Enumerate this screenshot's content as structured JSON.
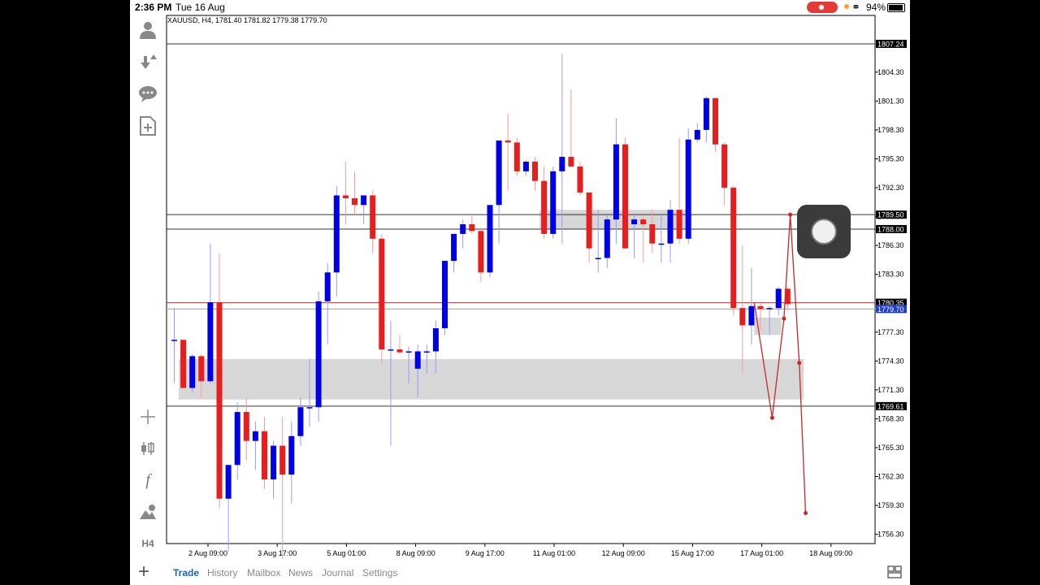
{
  "status_bar": {
    "time": "2:36 PM",
    "date": "Tue 16 Aug",
    "battery": "94%"
  },
  "sidebar": {
    "top_icons": [
      "person-icon",
      "download-icon",
      "chat-icon",
      "new-document-icon"
    ],
    "tool_icons": [
      "crosshair-icon",
      "chart-type-icon",
      "indicator-icon",
      "objects-icon"
    ],
    "timeframe": "H4"
  },
  "chart": {
    "symbol_info": "XAUUSD, H4, 1781.40 1781.82 1779.38 1779.70",
    "bull_color": "#0000e6",
    "bear_color": "#e61e1e",
    "price_ticks": [
      "1804.30",
      "1801.30",
      "1798.30",
      "1795.30",
      "1792.30",
      "1789.30",
      "1786.30",
      "1783.30",
      "1777.30",
      "1774.30",
      "1771.30",
      "1768.30",
      "1765.30",
      "1762.30",
      "1759.30",
      "1756.30"
    ],
    "price_tags": [
      {
        "label": "1807.24",
        "value": 1807.24,
        "type": "line"
      },
      {
        "label": "1789.50",
        "value": 1789.5,
        "type": "line"
      },
      {
        "label": "1788.00",
        "value": 1788.0,
        "type": "line"
      },
      {
        "label": "1780.35",
        "value": 1780.35,
        "type": "ask"
      },
      {
        "label": "1779.70",
        "value": 1779.7,
        "type": "bid"
      },
      {
        "label": "1769.61",
        "value": 1769.61,
        "type": "line"
      }
    ],
    "date_labels": [
      "2 Aug 09:00",
      "3 Aug 17:00",
      "5 Aug 01:00",
      "8 Aug 09:00",
      "9 Aug 17:00",
      "11 Aug 01:00",
      "12 Aug 09:00",
      "15 Aug 17:00",
      "17 Aug 01:00",
      "18 Aug 09:00"
    ],
    "candles": [
      [
        1776.5,
        1779.8,
        1772.0,
        1776.5
      ],
      [
        1776.5,
        1776.5,
        1771.5,
        1771.5
      ],
      [
        1771.5,
        1775.0,
        1771.0,
        1774.8
      ],
      [
        1774.8,
        1775.0,
        1770.5,
        1772.2
      ],
      [
        1772.2,
        1786.5,
        1772.0,
        1780.4
      ],
      [
        1780.4,
        1785.5,
        1759.0,
        1760.0
      ],
      [
        1760.0,
        1761.0,
        1754.5,
        1763.5
      ],
      [
        1763.5,
        1770.0,
        1762.0,
        1769.0
      ],
      [
        1769.0,
        1770.5,
        1764.0,
        1766.0
      ],
      [
        1766.0,
        1768.0,
        1763.0,
        1767.0
      ],
      [
        1767.0,
        1768.5,
        1761.0,
        1762.0
      ],
      [
        1762.0,
        1766.0,
        1760.0,
        1765.5
      ],
      [
        1765.5,
        1768.5,
        1753.0,
        1762.5
      ],
      [
        1762.5,
        1768.0,
        1759.5,
        1766.5
      ],
      [
        1766.5,
        1770.5,
        1765.5,
        1769.5
      ],
      [
        1769.5,
        1774.5,
        1767.5,
        1769.5
      ],
      [
        1769.5,
        1781.5,
        1768.0,
        1780.5
      ],
      [
        1780.5,
        1784.5,
        1776.0,
        1783.5
      ],
      [
        1783.5,
        1792.5,
        1781.0,
        1791.5
      ],
      [
        1791.5,
        1795.0,
        1788.5,
        1791.2
      ],
      [
        1791.2,
        1794.0,
        1789.5,
        1790.5
      ],
      [
        1790.5,
        1791.5,
        1788.5,
        1791.5
      ],
      [
        1791.5,
        1792.0,
        1785.5,
        1787.0
      ],
      [
        1787.0,
        1787.5,
        1774.0,
        1775.5
      ],
      [
        1775.5,
        1778.5,
        1765.5,
        1775.5
      ],
      [
        1775.5,
        1777.0,
        1775.0,
        1775.2
      ],
      [
        1775.2,
        1775.8,
        1772.0,
        1775.3
      ],
      [
        1773.5,
        1776.0,
        1770.5,
        1775.3
      ],
      [
        1775.3,
        1776.0,
        1773.0,
        1775.3
      ],
      [
        1775.3,
        1778.5,
        1773.0,
        1777.7
      ],
      [
        1777.7,
        1784.5,
        1777.0,
        1784.7
      ],
      [
        1784.7,
        1787.0,
        1783.5,
        1787.5
      ],
      [
        1787.5,
        1789.0,
        1786.0,
        1788.5
      ],
      [
        1788.5,
        1789.5,
        1787.5,
        1787.8
      ],
      [
        1787.8,
        1788.0,
        1782.5,
        1783.5
      ],
      [
        1783.5,
        1789.0,
        1783.0,
        1790.5
      ],
      [
        1790.5,
        1794.0,
        1786.5,
        1797.2
      ],
      [
        1797.2,
        1800.0,
        1792.0,
        1797.0
      ],
      [
        1797.0,
        1797.5,
        1793.5,
        1794.0
      ],
      [
        1794.0,
        1795.2,
        1793.5,
        1795.0
      ],
      [
        1795.0,
        1795.5,
        1792.0,
        1793.0
      ],
      [
        1793.0,
        1794.5,
        1787.0,
        1787.5
      ],
      [
        1787.5,
        1794.5,
        1787.0,
        1794.0
      ],
      [
        1794.0,
        1806.2,
        1786.5,
        1795.5
      ],
      [
        1795.5,
        1802.5,
        1795.0,
        1794.5
      ],
      [
        1794.5,
        1795.0,
        1791.5,
        1791.8
      ],
      [
        1791.8,
        1789.5,
        1784.5,
        1786.0
      ],
      [
        1785.0,
        1790.0,
        1783.5,
        1785.0
      ],
      [
        1785.0,
        1789.5,
        1784.0,
        1789.0
      ],
      [
        1789.0,
        1799.5,
        1786.5,
        1796.8
      ],
      [
        1796.8,
        1797.5,
        1787.5,
        1786.0
      ],
      [
        1788.5,
        1789.5,
        1785.0,
        1789.0
      ],
      [
        1789.0,
        1789.5,
        1784.5,
        1788.5
      ],
      [
        1788.5,
        1790.0,
        1785.5,
        1786.5
      ],
      [
        1786.5,
        1789.5,
        1784.5,
        1786.5
      ],
      [
        1786.5,
        1791.0,
        1784.5,
        1790.0
      ],
      [
        1790.0,
        1797.5,
        1786.5,
        1787.0
      ],
      [
        1787.0,
        1798.5,
        1786.5,
        1797.3
      ],
      [
        1797.3,
        1799.0,
        1797.0,
        1798.3
      ],
      [
        1798.3,
        1801.8,
        1797.0,
        1801.6
      ],
      [
        1801.6,
        1801.0,
        1796.0,
        1796.8
      ],
      [
        1796.8,
        1797.0,
        1790.5,
        1792.3
      ],
      [
        1792.3,
        1792.5,
        1779.0,
        1779.8
      ],
      [
        1779.8,
        1786.3,
        1773.0,
        1778.0
      ],
      [
        1778.0,
        1784.0,
        1776.0,
        1780.0
      ],
      [
        1780.0,
        1780.5,
        1777.5,
        1779.7
      ],
      [
        1779.7,
        1780.0,
        1777.0,
        1779.8
      ],
      [
        1779.8,
        1782.0,
        1779.0,
        1781.8
      ],
      [
        1781.8,
        1782.0,
        1779.5,
        1780.2
      ]
    ],
    "zones": [
      {
        "x1": 40.5,
        "x2": 57.0,
        "top": 1790.0,
        "bottom": 1788.0
      },
      {
        "x1": 0.5,
        "x2": 69.8,
        "top": 1774.5,
        "bottom": 1770.3
      },
      {
        "x1": 64.3,
        "x2": 67.3,
        "top": 1778.8,
        "bottom": 1777.0
      }
    ],
    "projection": [
      [
        64.3,
        1780.4
      ],
      [
        66.3,
        1768.4
      ],
      [
        67.6,
        1778.7
      ],
      [
        68.3,
        1789.5
      ],
      [
        69.3,
        1774.1
      ],
      [
        70.0,
        1758.5
      ]
    ]
  },
  "bottom_tabs": [
    {
      "label": "Trade",
      "active": true
    },
    {
      "label": "History",
      "active": false
    },
    {
      "label": "Mailbox",
      "active": false
    },
    {
      "label": "News",
      "active": false
    },
    {
      "label": "Journal",
      "active": false
    },
    {
      "label": "Settings",
      "active": false
    }
  ]
}
